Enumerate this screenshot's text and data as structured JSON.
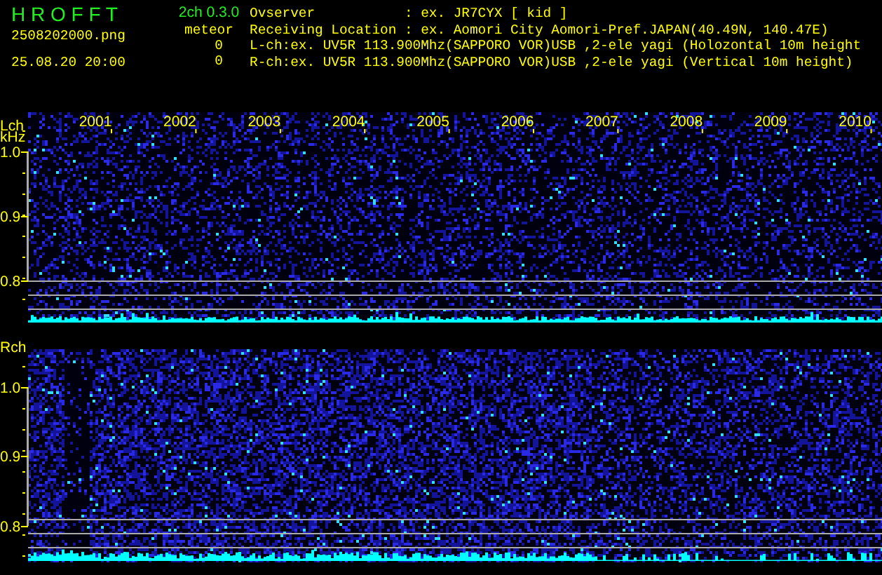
{
  "header": {
    "app_title": "H R O F F T",
    "version": "2ch 0.3.0",
    "file_name": "2508202000.png",
    "date_time": "25.08.20 20:00",
    "meteor_label": "meteor",
    "meteor_counts": [
      "0",
      "0"
    ],
    "info_lines": [
      "Ovserver           : ex. JR7CYX [ kid ]",
      "Receiving Location : ex. Aomori City Aomori-Pref.JAPAN(40.49N, 140.47E)",
      "L-ch:ex. UV5R 113.900Mhz(SAPPORO VOR)USB ,2-ele yagi (Holozontal 10m height",
      "R-ch:ex. UV5R 113.900Mhz(SAPPORO VOR)USB ,2-ele yagi (Vertical 10m height)"
    ]
  },
  "spectrograms": [
    {
      "channel": "Lch",
      "unit": "kHz",
      "years": [
        "2001",
        "2002",
        "2003",
        "2004",
        "2005",
        "2006",
        "2007",
        "2008",
        "2009",
        "2010"
      ],
      "yticks": [
        "1.0",
        "0.9",
        "0.8"
      ]
    },
    {
      "channel": "Rch",
      "yticks": [
        "1.0",
        "0.9",
        "0.8"
      ]
    }
  ]
}
